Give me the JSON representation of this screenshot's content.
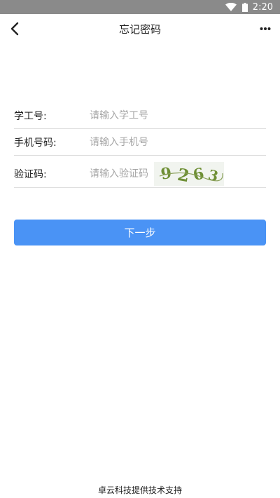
{
  "status_bar": {
    "time": "2:20",
    "icons": [
      "wifi-icon",
      "battery-icon"
    ]
  },
  "nav": {
    "title": "忘记密码",
    "back_icon": "chevron-left-icon",
    "more_icon": "more-dots-icon"
  },
  "form": {
    "student_id": {
      "label": "学工号:",
      "placeholder": "请输入学工号",
      "value": ""
    },
    "phone": {
      "label": "手机号码:",
      "placeholder": "请输入手机号",
      "value": ""
    },
    "captcha": {
      "label": "验证码:",
      "placeholder": "请输入验证码",
      "value": "",
      "image_text": "9263"
    }
  },
  "next_button": {
    "label": "下一步",
    "color": "#4a93f5"
  },
  "footer": {
    "text": "卓云科技提供技术支持"
  }
}
